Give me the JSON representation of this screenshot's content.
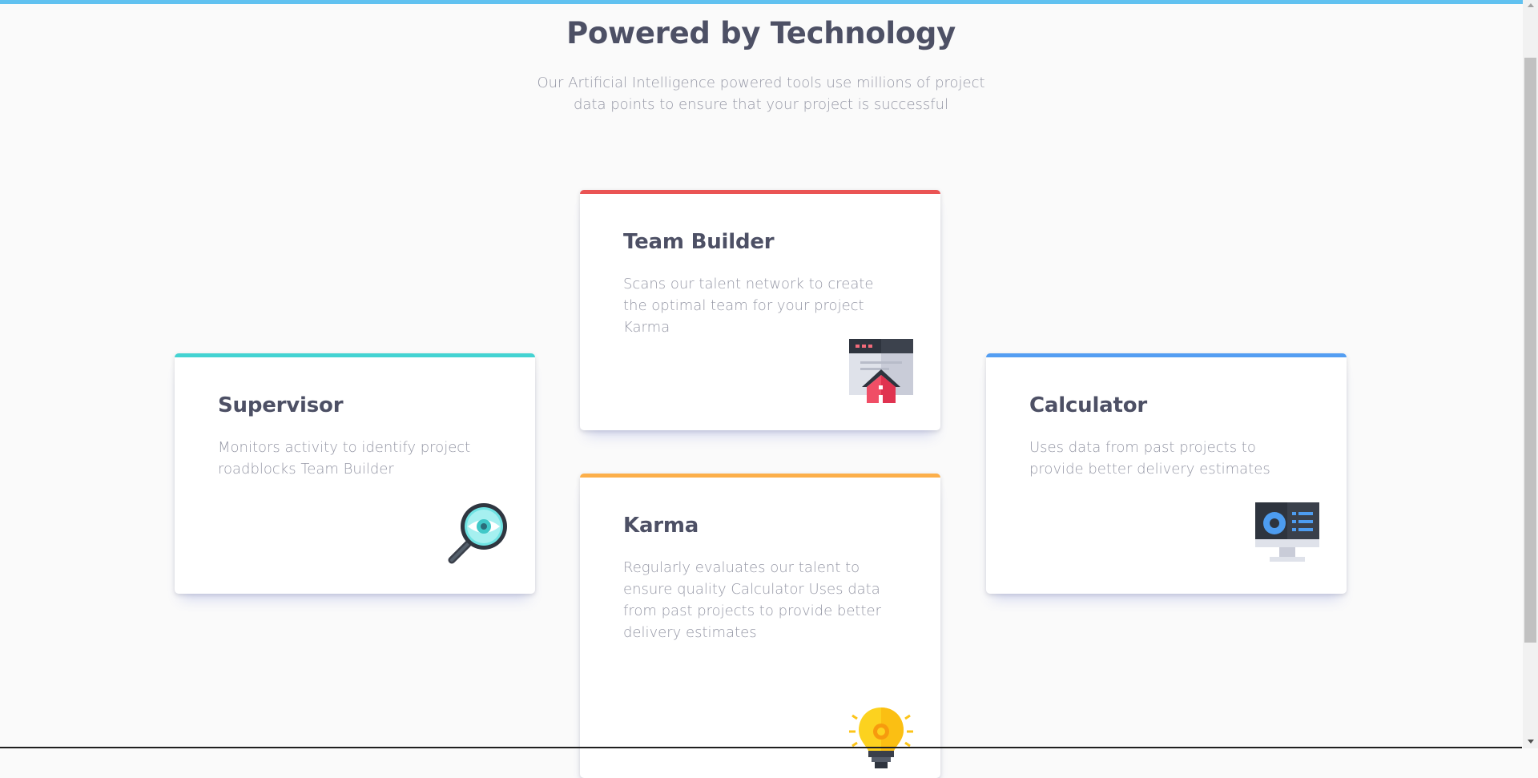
{
  "header": {
    "title": "Powered by Technology",
    "subtitle": "Our Artificial Intelligence powered tools use millions of project data points to ensure that your project is successful"
  },
  "cards": [
    {
      "title": "Supervisor",
      "description": "Monitors activity to identify project roadblocks Team Builder",
      "icon": "magnifier-eye-icon",
      "accent": "#44d3d2"
    },
    {
      "title": "Team Builder",
      "description": "Scans our talent network to create the optimal team for your project Karma",
      "icon": "house-window-icon",
      "accent": "#ea5454"
    },
    {
      "title": "Karma",
      "description": "Regularly evaluates our talent to ensure quality Calculator Uses data from past projects to provide better delivery estimates",
      "icon": "lightbulb-icon",
      "accent": "#fcaf4a"
    },
    {
      "title": "Calculator",
      "description": "Uses data from past projects to provide better delivery estimates",
      "icon": "monitor-chart-icon",
      "accent": "#549ef2"
    }
  ],
  "colors": {
    "top_bar": "#60c1f0",
    "text_dark": "#4d5065",
    "text_muted": "#9698a6"
  }
}
